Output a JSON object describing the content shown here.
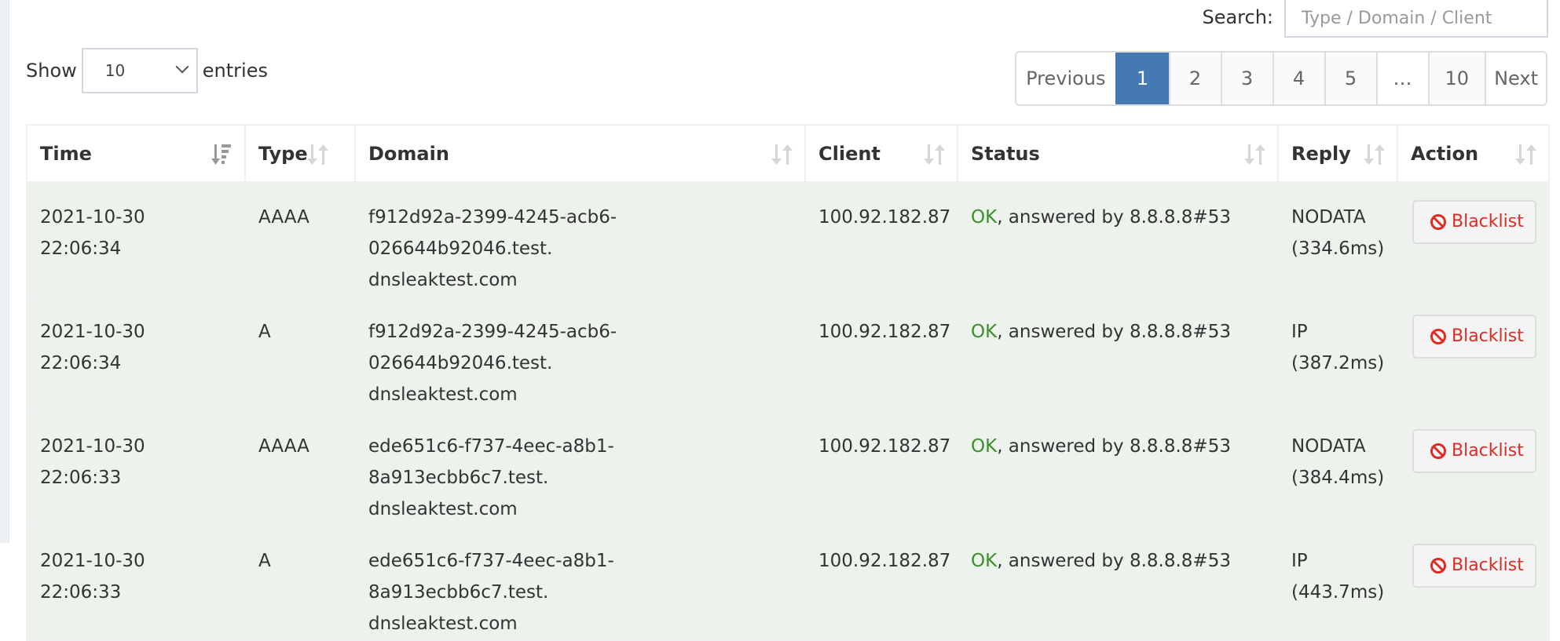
{
  "search": {
    "label": "Search:",
    "placeholder": "Type / Domain / Client"
  },
  "length": {
    "show_label": "Show",
    "selected": "10",
    "entries_label": "entries"
  },
  "pagination": {
    "previous": "Previous",
    "pages": [
      "1",
      "2",
      "3",
      "4",
      "5",
      "…",
      "10"
    ],
    "active_page": "1",
    "next": "Next",
    "active_color": "#4579b2"
  },
  "table": {
    "columns": [
      {
        "label": "Time",
        "sort": "descending"
      },
      {
        "label": "Type",
        "sort": "none"
      },
      {
        "label": "Domain",
        "sort": "none"
      },
      {
        "label": "Client",
        "sort": "none"
      },
      {
        "label": "Status",
        "sort": "none"
      },
      {
        "label": "Reply",
        "sort": "none"
      },
      {
        "label": "Action",
        "sort": "none"
      }
    ],
    "rows": [
      {
        "time": "2021-10-30 22:06:34",
        "type": "AAAA",
        "domain_line1": "f912d92a-2399-4245-acb6-026644b92046.test.",
        "domain_line2": "dnsleaktest.com",
        "client": "100.92.182.87",
        "status_ok": "OK",
        "status_rest": ", answered by 8.8.8.8#53",
        "reply_type": "NODATA",
        "reply_time": "(334.6ms)",
        "action": "Blacklist"
      },
      {
        "time": "2021-10-30 22:06:34",
        "type": "A",
        "domain_line1": "f912d92a-2399-4245-acb6-026644b92046.test.",
        "domain_line2": "dnsleaktest.com",
        "client": "100.92.182.87",
        "status_ok": "OK",
        "status_rest": ", answered by 8.8.8.8#53",
        "reply_type": "IP",
        "reply_time": "(387.2ms)",
        "action": "Blacklist"
      },
      {
        "time": "2021-10-30 22:06:33",
        "type": "AAAA",
        "domain_line1": "ede651c6-f737-4eec-a8b1-8a913ecbb6c7.test.",
        "domain_line2": "dnsleaktest.com",
        "client": "100.92.182.87",
        "status_ok": "OK",
        "status_rest": ", answered by 8.8.8.8#53",
        "reply_type": "NODATA",
        "reply_time": "(384.4ms)",
        "action": "Blacklist"
      },
      {
        "time": "2021-10-30 22:06:33",
        "type": "A",
        "domain_line1": "ede651c6-f737-4eec-a8b1-8a913ecbb6c7.test.",
        "domain_line2": "dnsleaktest.com",
        "client": "100.92.182.87",
        "status_ok": "OK",
        "status_rest": ", answered by 8.8.8.8#53",
        "reply_type": "IP",
        "reply_time": "(443.7ms)",
        "action": "Blacklist"
      }
    ]
  },
  "colors": {
    "row_allowed_bg": "#ecf3ec",
    "status_ok": "#3c8e2b",
    "blacklist": "#dd2c25"
  }
}
